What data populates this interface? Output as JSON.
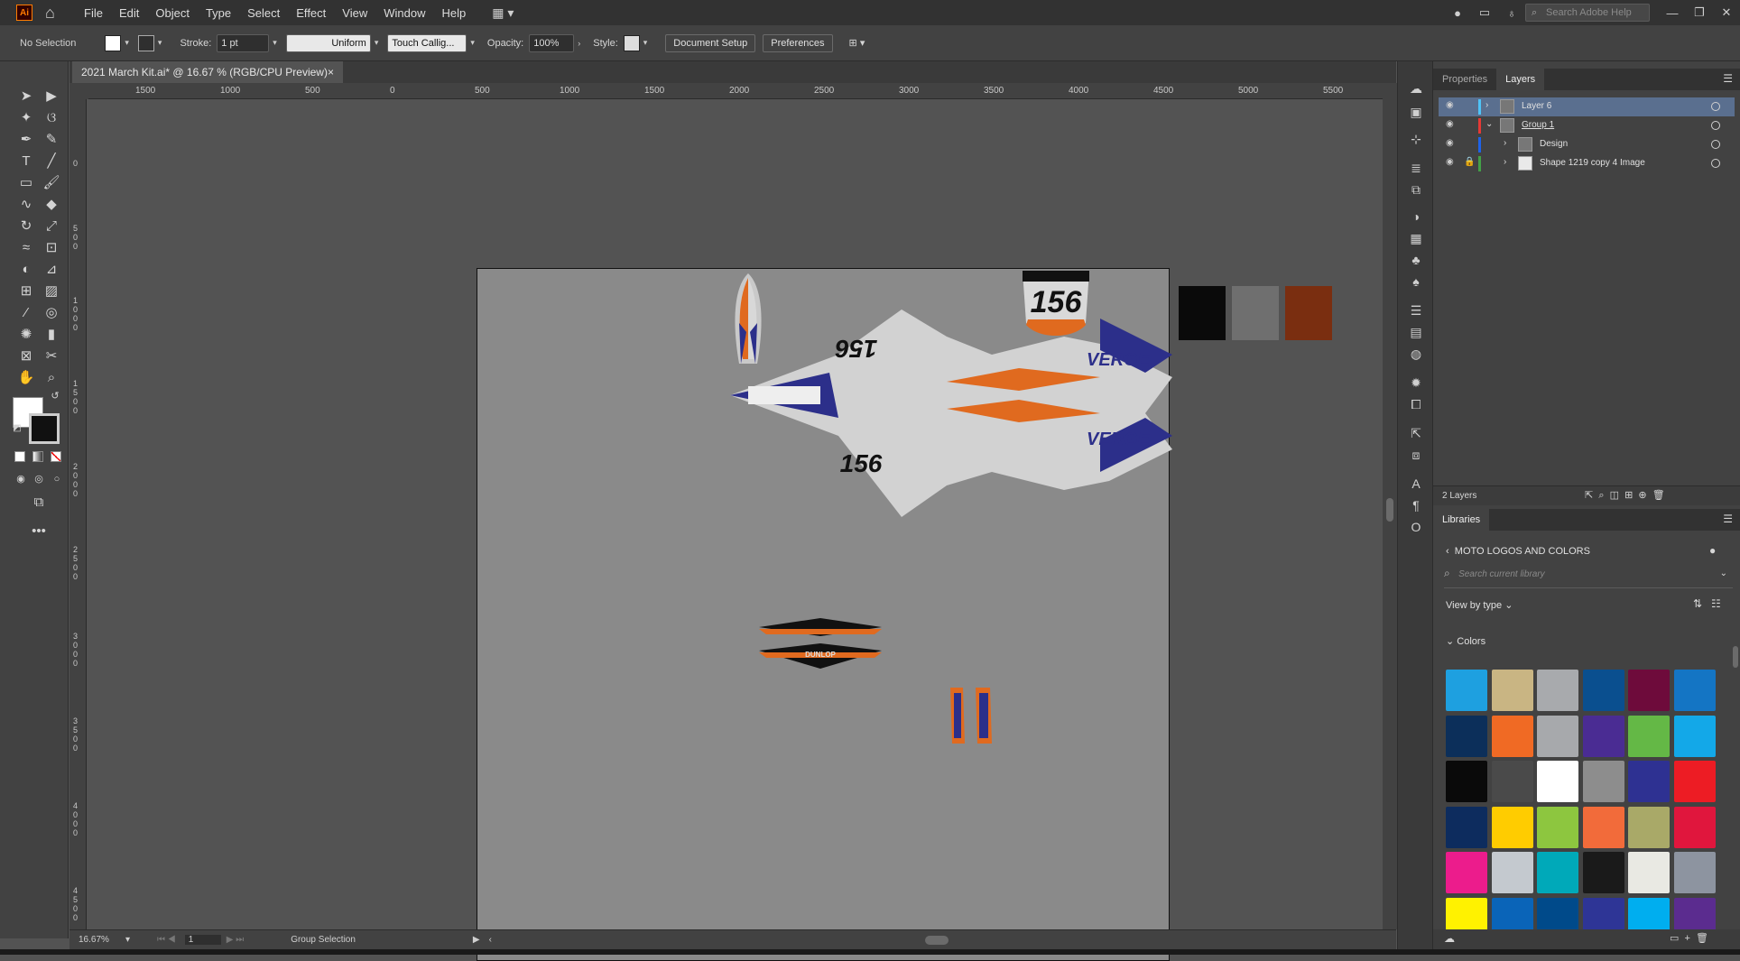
{
  "app": {
    "logo": "Ai",
    "menus": [
      "File",
      "Edit",
      "Object",
      "Type",
      "Select",
      "Effect",
      "View",
      "Window",
      "Help"
    ],
    "search_placeholder": "Search Adobe Help"
  },
  "control": {
    "selection": "No Selection",
    "stroke_label": "Stroke:",
    "stroke_value": "1 pt",
    "profile": "Uniform",
    "brush": "Touch Callig...",
    "opacity_label": "Opacity:",
    "opacity_value": "100%",
    "style_label": "Style:",
    "doc_setup": "Document Setup",
    "preferences": "Preferences"
  },
  "document": {
    "tab_title": "2021 March Kit.ai* @ 16.67 % (RGB/CPU Preview)",
    "close": "×"
  },
  "ruler": {
    "h_labels": [
      "1500",
      "1000",
      "500",
      "0",
      "500",
      "1000",
      "1500",
      "2000",
      "2500",
      "3000",
      "3500",
      "4000",
      "4500",
      "5000",
      "5500"
    ],
    "v_labels": [
      "0",
      "5 0 0",
      "1 0 0 0",
      "1 5 0 0",
      "2 0 0 0",
      "2 5 0 0",
      "3 0 0 0",
      "3 5 0 0",
      "4 0 0 0",
      "4 5 0 0"
    ]
  },
  "artwork": {
    "race_number": "156",
    "brand": "VERGE",
    "sponsor": "DUNLOP"
  },
  "status": {
    "zoom": "16.67%",
    "artboard": "1",
    "tool": "Group Selection"
  },
  "panels": {
    "tabs": [
      "Properties",
      "Layers"
    ],
    "layers": [
      {
        "name": "Layer 6",
        "color": "#4fc3f7",
        "expand": "›",
        "selected": true
      },
      {
        "name": "Group 1",
        "color": "#e53935",
        "expand": "⌄",
        "selected": false
      },
      {
        "name": "Design",
        "color": "#1e63e9",
        "expand": "›",
        "selected": false
      },
      {
        "name": "Shape 1219 copy 4 Image",
        "color": "#43a047",
        "expand": "›",
        "selected": false,
        "locked": true
      }
    ],
    "layers_count": "2 Layers",
    "libraries_tab": "Libraries",
    "library_name": "MOTO LOGOS AND COLORS",
    "library_search": "Search current library",
    "view_by": "View by type",
    "colors_header": "Colors",
    "colors": [
      "#1ea0e0",
      "#c9b583",
      "#a8aaad",
      "#0a4f8f",
      "#6e0b3b",
      "#1475c4",
      "#0c2f5a",
      "#f06a24",
      "#a7a9ac",
      "#4a2c93",
      "#64b846",
      "#13a8e8",
      "#0a0a0a",
      "#4a4a4a",
      "#ffffff",
      "#8d8d8d",
      "#2e3192",
      "#ed1c24",
      "#0d2c5e",
      "#ffcc00",
      "#8dc63f",
      "#f26b3a",
      "#a9a968",
      "#e0163d",
      "#ec1c8c",
      "#c4c9cf",
      "#00a9b9",
      "#1a1a1a",
      "#e9e9e3",
      "#8d94a0",
      "#fff200",
      "#0a64b8",
      "#004a8a",
      "#2e3596",
      "#00aeef",
      "#5b2c8f"
    ],
    "doc_swatches": [
      "#0a0a0a",
      "#6f6f6f",
      "#7a2e10"
    ]
  }
}
